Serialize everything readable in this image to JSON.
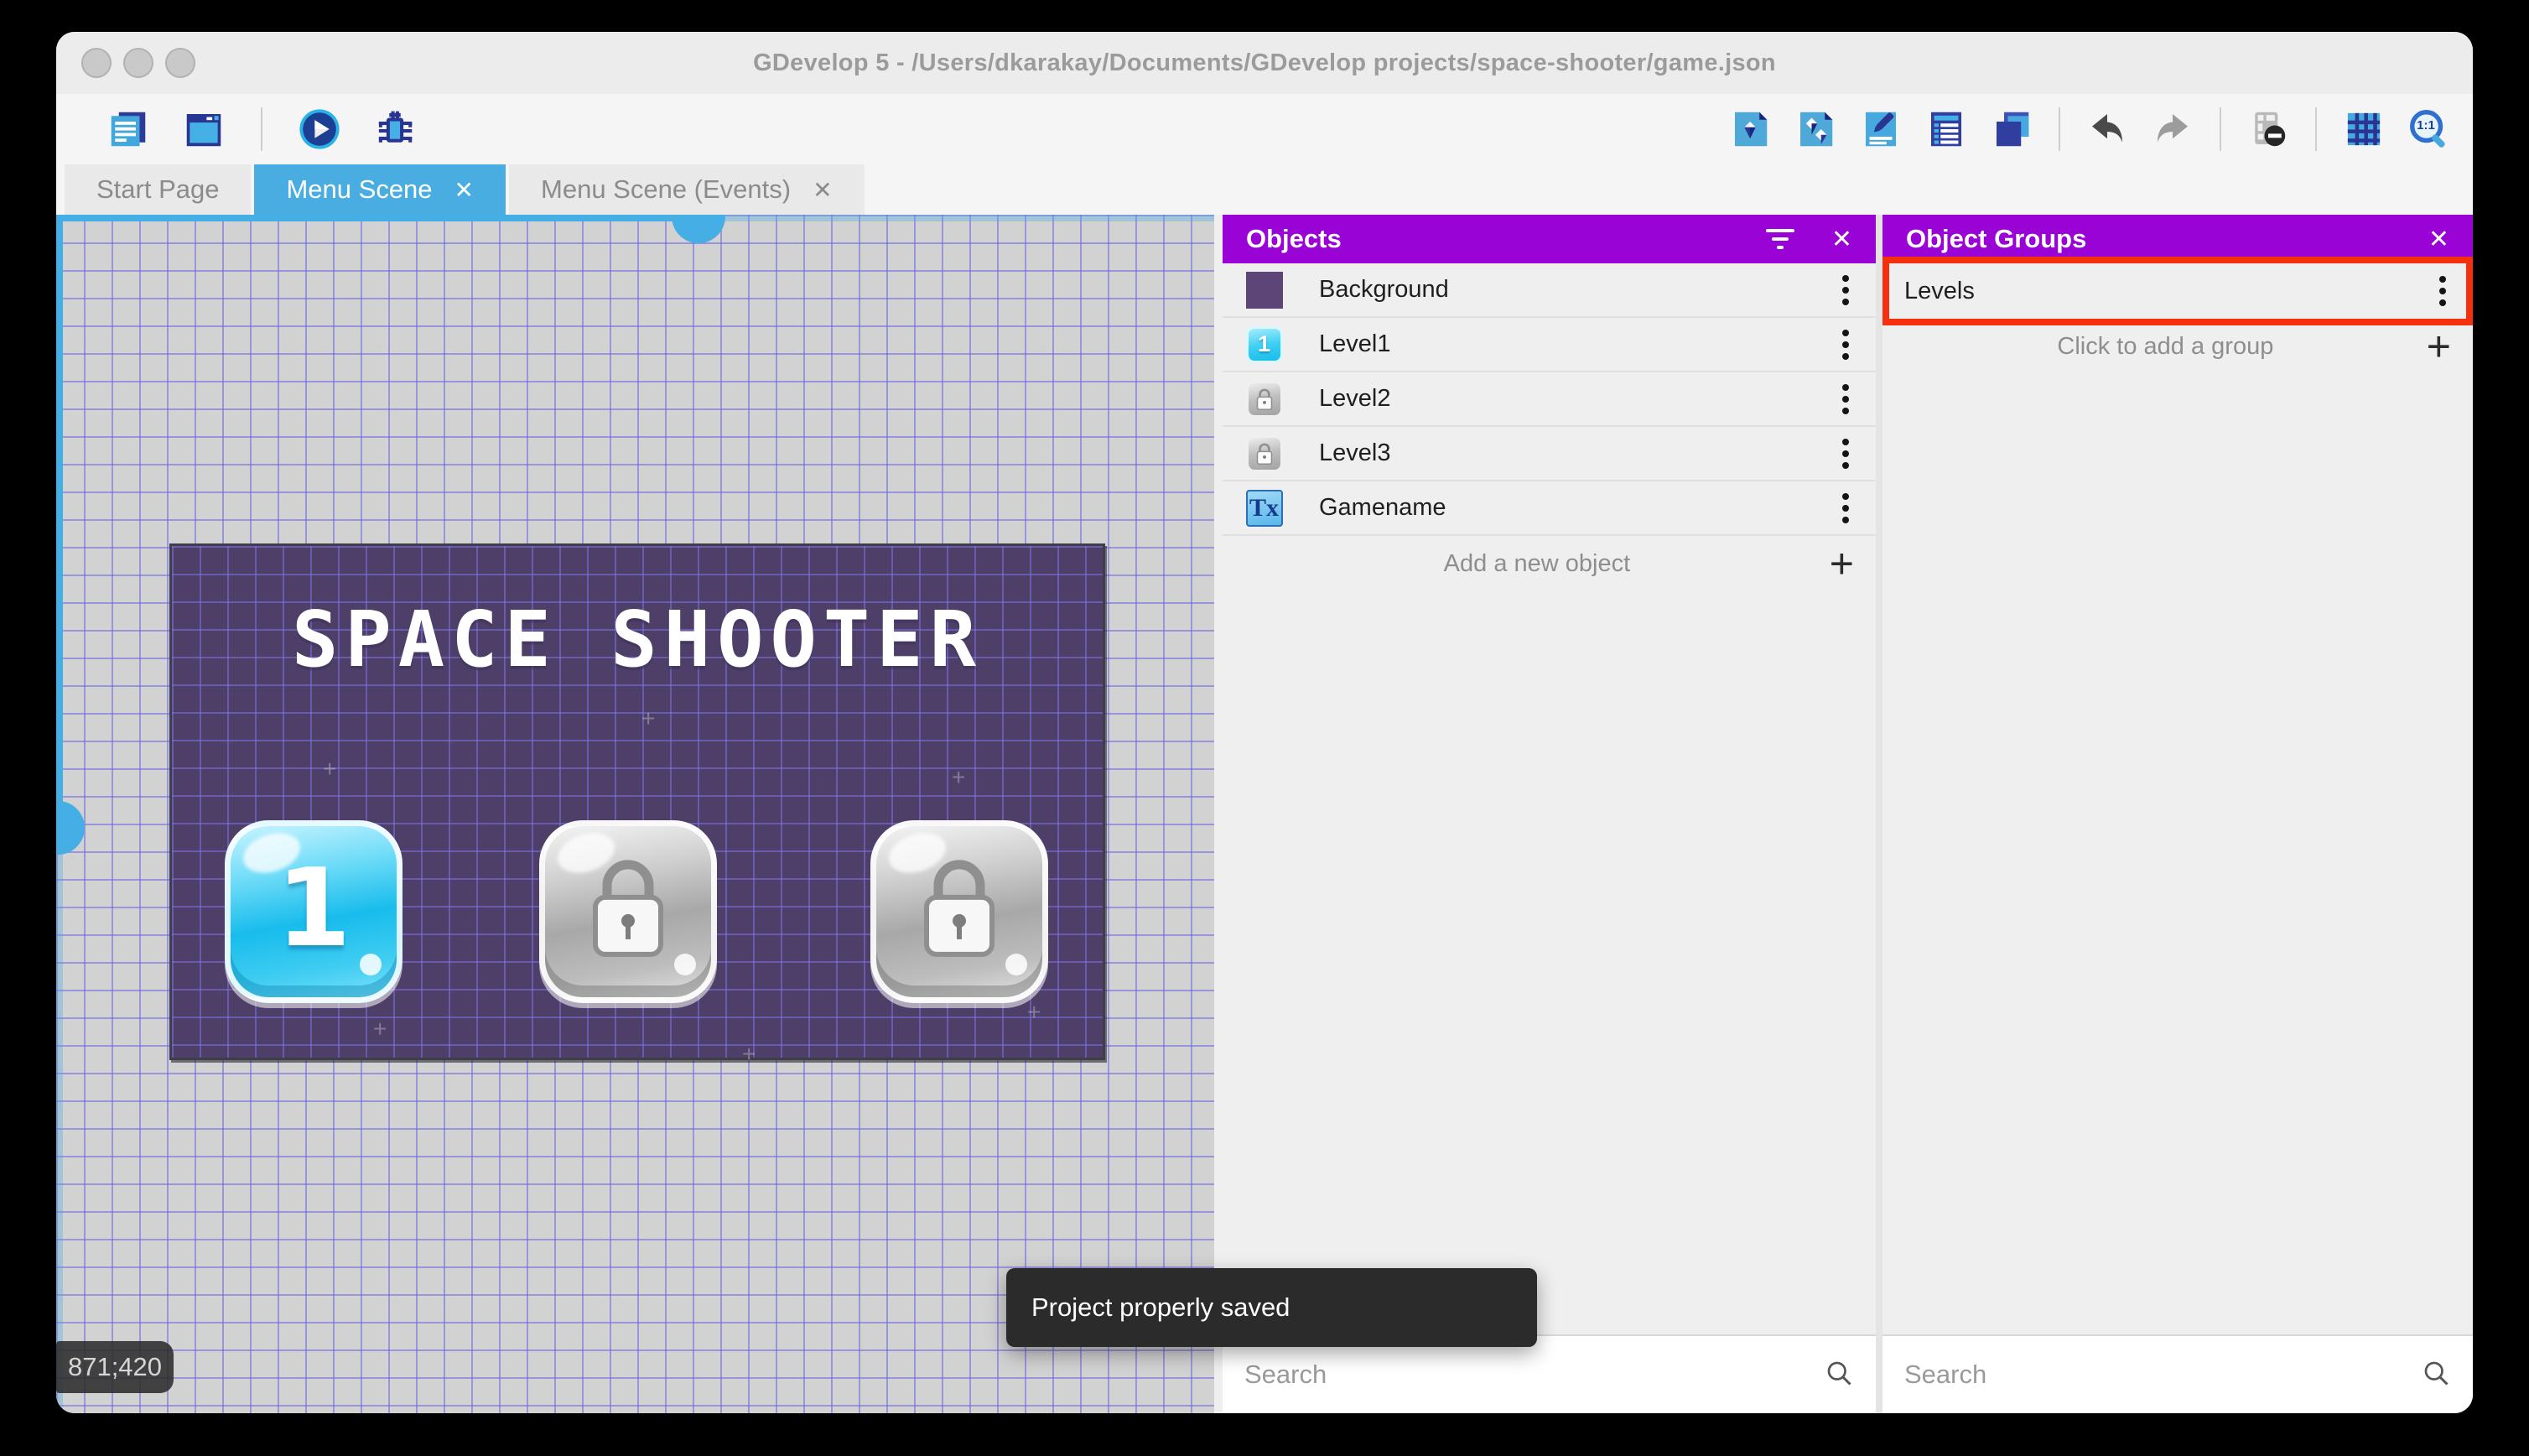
{
  "window": {
    "title": "GDevelop 5 - /Users/dkarakay/Documents/GDevelop projects/space-shooter/game.json"
  },
  "toolbar": {
    "left_icons": [
      "project-manager",
      "scene-window",
      "play",
      "debug"
    ],
    "right_icons": [
      "objects-editor",
      "object-groups-editor",
      "properties",
      "instances-list",
      "layers",
      "undo",
      "redo",
      "toggle-instances-mask",
      "grid",
      "zoom-original"
    ],
    "zoom_badge": "1:1"
  },
  "tabs": [
    {
      "label": "Start Page",
      "active": false
    },
    {
      "label": "Menu Scene",
      "active": true,
      "close_glyph": "✕"
    },
    {
      "label": "Menu Scene (Events)",
      "active": false,
      "close_glyph": "✕"
    }
  ],
  "canvas": {
    "coordinates": "871;420",
    "toast": "Project properly saved",
    "scene": {
      "title": "SPACE SHOOTER",
      "buttons": [
        {
          "label": "1",
          "state": "unlocked"
        },
        {
          "label": "",
          "state": "locked"
        },
        {
          "label": "",
          "state": "locked"
        }
      ]
    }
  },
  "objects_panel": {
    "title": "Objects",
    "items": [
      {
        "name": "Background",
        "icon": "background-thumbnail",
        "icon_glyph": ""
      },
      {
        "name": "Level1",
        "icon": "level-button-unlocked",
        "icon_glyph": "1"
      },
      {
        "name": "Level2",
        "icon": "level-button-locked",
        "icon_glyph": ""
      },
      {
        "name": "Level3",
        "icon": "level-button-locked",
        "icon_glyph": ""
      },
      {
        "name": "Gamename",
        "icon": "text-object",
        "icon_glyph": "Tx"
      }
    ],
    "add_label": "Add a new object",
    "add_glyph": "+",
    "search": {
      "placeholder": "Search"
    }
  },
  "object_groups_panel": {
    "title": "Object Groups",
    "groups": [
      {
        "name": "Levels",
        "highlighted": true
      }
    ],
    "add_label": "Click to add a group",
    "add_glyph": "+",
    "search": {
      "placeholder": "Search"
    }
  },
  "colors": {
    "panel_header_purple": "#9903d6",
    "active_tab_blue": "#4aade2",
    "scrollbar_blue": "#45aee5",
    "annotation_red": "#f4300e",
    "toast_bg": "#2b2b2b",
    "scene_background": "#4e3f68",
    "canvas_background": "#d2d2d2"
  }
}
